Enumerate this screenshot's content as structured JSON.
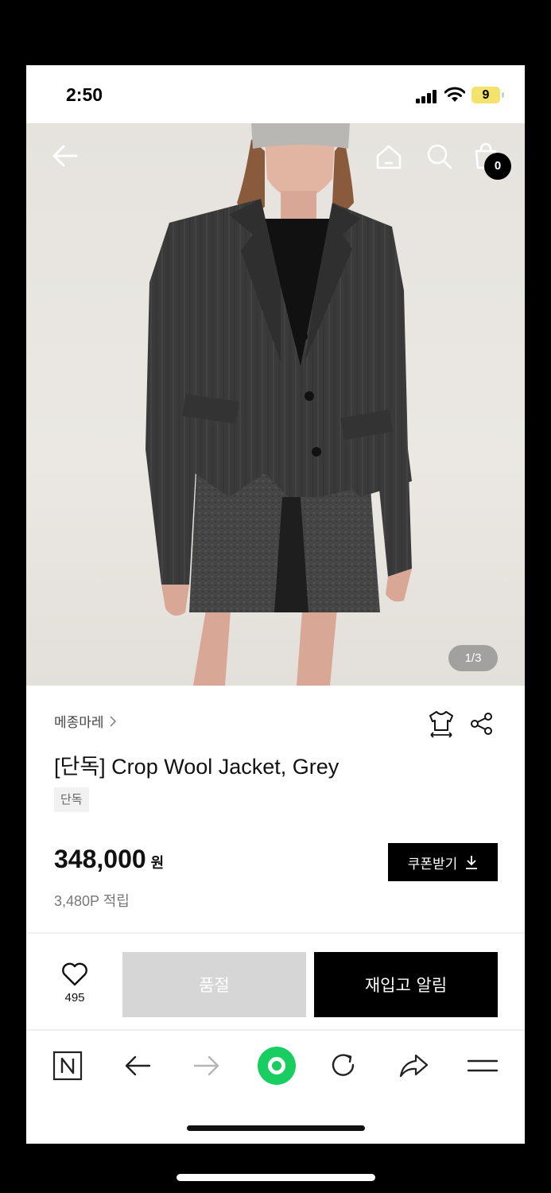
{
  "status_bar": {
    "time": "2:50",
    "battery": "9",
    "icons": [
      "signal-icon",
      "wifi-icon",
      "battery-icon"
    ]
  },
  "hero": {
    "image_counter": "1/3",
    "cart_count": "0",
    "icons": [
      "back-arrow-icon",
      "home-icon",
      "search-icon",
      "shopping-bag-icon"
    ]
  },
  "product": {
    "brand": "메종마레",
    "title": "[단독] Crop Wool Jacket, Grey",
    "tag": "단독",
    "price": "348,000",
    "price_unit": "원",
    "points": "3,480P 적립",
    "coupon_label": "쿠폰받기"
  },
  "actions": {
    "like_count": "495",
    "soldout_label": "품절",
    "restock_label": "재입고 알림"
  },
  "browser_bar": {
    "icons": [
      "naver-n-icon",
      "back-icon",
      "forward-icon",
      "green-dot-icon",
      "refresh-icon",
      "share-icon",
      "menu-icon"
    ]
  },
  "colors": {
    "accent_green": "#19ce60",
    "black": "#000000",
    "soldout_grey": "#d6d6d6"
  }
}
